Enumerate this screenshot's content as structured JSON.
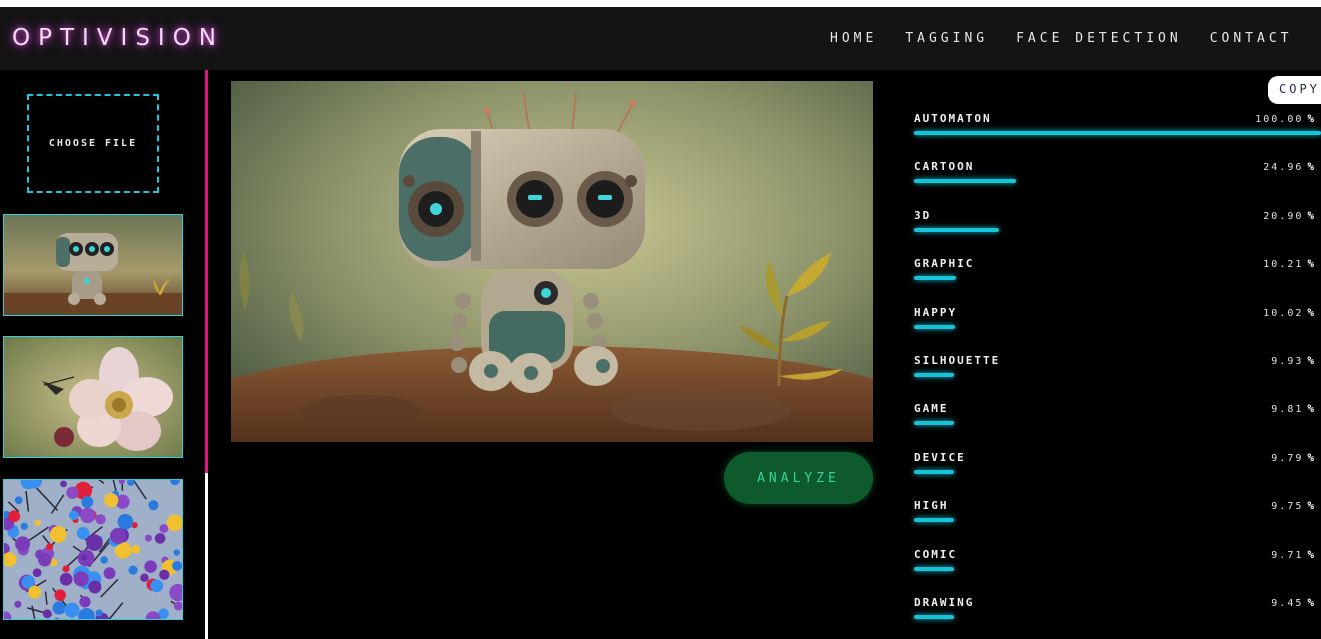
{
  "app": {
    "logo": "OPTIVISION"
  },
  "nav": {
    "items": [
      "HOME",
      "TAGGING",
      "FACE DETECTION",
      "CONTACT"
    ]
  },
  "sidebar": {
    "choose_file_label": "CHOOSE FILE",
    "thumbnails": [
      "robot-thumbnail",
      "flower-thumbnail",
      "molecules-thumbnail"
    ]
  },
  "main": {
    "analyze_label": "ANALYZE",
    "copy_label": "COPY"
  },
  "tags": [
    {
      "name": "AUTOMATON",
      "value": "100.00",
      "fraction": 1.0
    },
    {
      "name": "CARTOON",
      "value": "24.96",
      "fraction": 0.2496
    },
    {
      "name": "3D",
      "value": "20.90",
      "fraction": 0.209
    },
    {
      "name": "GRAPHIC",
      "value": "10.21",
      "fraction": 0.1021
    },
    {
      "name": "HAPPY",
      "value": "10.02",
      "fraction": 0.1002
    },
    {
      "name": "SILHOUETTE",
      "value": "9.93",
      "fraction": 0.0993
    },
    {
      "name": "GAME",
      "value": "9.81",
      "fraction": 0.0981
    },
    {
      "name": "DEVICE",
      "value": "9.79",
      "fraction": 0.0979
    },
    {
      "name": "HIGH",
      "value": "9.75",
      "fraction": 0.0975
    },
    {
      "name": "COMIC",
      "value": "9.71",
      "fraction": 0.0971
    },
    {
      "name": "DRAWING",
      "value": "9.45",
      "fraction": 0.0945
    }
  ],
  "percent_sign": "%",
  "colors": {
    "accent": "#16c4d8",
    "sidebar_border": "#e0158a",
    "analyze_bg": "#0f5a2c",
    "logo_glow": "#d04ad8"
  }
}
